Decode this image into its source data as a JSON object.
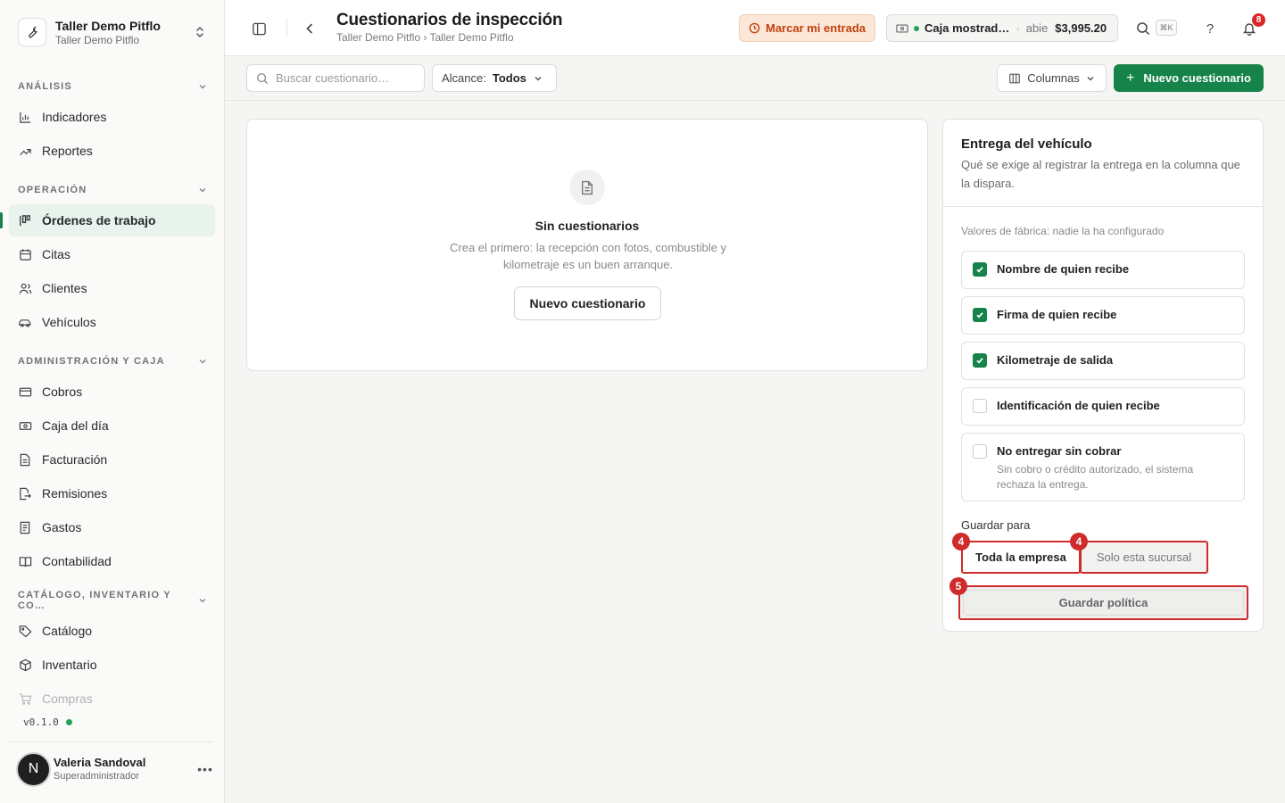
{
  "org": {
    "name": "Taller Demo Pitflo",
    "subtitle": "Taller Demo Pitflo"
  },
  "sidebar": {
    "sections": [
      {
        "label": "ANÁLISIS"
      },
      {
        "label": "OPERACIÓN"
      },
      {
        "label": "ADMINISTRACIÓN Y CAJA"
      },
      {
        "label": "CATÁLOGO, INVENTARIO Y CO…"
      }
    ],
    "items": [
      {
        "label": "Indicadores",
        "icon": "bar-chart-icon"
      },
      {
        "label": "Reportes",
        "icon": "trend-up-icon"
      },
      {
        "label": "Órdenes de trabajo",
        "icon": "kanban-icon",
        "active": true
      },
      {
        "label": "Citas",
        "icon": "calendar-icon"
      },
      {
        "label": "Clientes",
        "icon": "users-icon"
      },
      {
        "label": "Vehículos",
        "icon": "car-icon"
      },
      {
        "label": "Cobros",
        "icon": "credit-card-icon"
      },
      {
        "label": "Caja del día",
        "icon": "cash-icon"
      },
      {
        "label": "Facturación",
        "icon": "file-icon"
      },
      {
        "label": "Remisiones",
        "icon": "file-export-icon"
      },
      {
        "label": "Gastos",
        "icon": "receipt-icon"
      },
      {
        "label": "Contabilidad",
        "icon": "book-icon"
      },
      {
        "label": "Catálogo",
        "icon": "tag-icon"
      },
      {
        "label": "Inventario",
        "icon": "box-icon"
      },
      {
        "label": "Compras",
        "icon": "cart-icon"
      }
    ],
    "version": "v0.1.0"
  },
  "user": {
    "initial": "N",
    "name": "Valeria Sandoval",
    "role": "Superadministrador"
  },
  "header": {
    "title": "Cuestionarios de inspección",
    "breadcrumb": "Taller Demo Pitflo › Taller Demo Pitflo",
    "clock_in_label": "Marcar mi entrada",
    "register": {
      "name": "Caja mostrad…",
      "separator": "·",
      "status": "abie",
      "amount": "$3,995.20"
    },
    "shortcut": "⌘K",
    "notifications_count": "8"
  },
  "toolbar": {
    "search_placeholder": "Buscar cuestionario…",
    "scope_label": "Alcance:",
    "scope_value": "Todos",
    "columns_label": "Columnas",
    "new_label": "Nuevo cuestionario"
  },
  "empty_state": {
    "title": "Sin cuestionarios",
    "description": "Crea el primero: la recepción con fotos, combustible y kilometraje es un buen arranque.",
    "button": "Nuevo cuestionario"
  },
  "panel": {
    "title": "Entrega del vehículo",
    "subtitle": "Qué se exige al registrar la entrega en la columna que la dispara.",
    "note": "Valores de fábrica: nadie la ha configurado",
    "options": [
      {
        "label": "Nombre de quien recibe",
        "checked": true
      },
      {
        "label": "Firma de quien recibe",
        "checked": true
      },
      {
        "label": "Kilometraje de salida",
        "checked": true
      },
      {
        "label": "Identificación de quien recibe",
        "checked": false
      },
      {
        "label": "No entregar sin cobrar",
        "hint": "Sin cobro o crédito autorizado, el sistema rechaza la entrega.",
        "checked": false
      }
    ],
    "save_for_label": "Guardar para",
    "scope_options": [
      "Toda la empresa",
      "Solo esta sucursal"
    ],
    "save_button": "Guardar política",
    "markers": [
      "4",
      "4",
      "5"
    ]
  },
  "colors": {
    "accent": "#16834a",
    "highlight": "#cf2b2b",
    "warning_bg": "#fbe7d8",
    "warning_text": "#c2410c"
  }
}
